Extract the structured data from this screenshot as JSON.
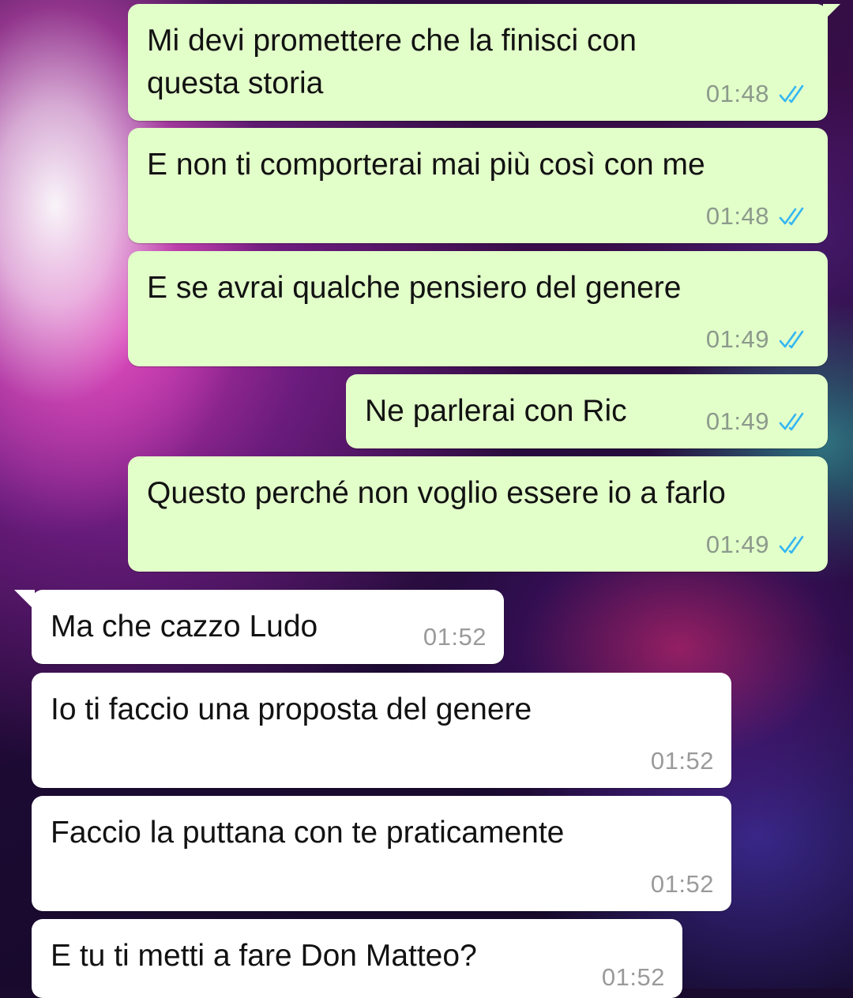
{
  "chat": {
    "messages": [
      {
        "direction": "out",
        "text": "Mi devi promettere che la finisci con\nquesta storia",
        "time": "01:48",
        "status_icon": "double-check-read-icon"
      },
      {
        "direction": "out",
        "text": "E non ti comporterai mai più così con me",
        "time": "01:48",
        "status_icon": "double-check-read-icon"
      },
      {
        "direction": "out",
        "text": "E se avrai qualche pensiero del genere",
        "time": "01:49",
        "status_icon": "double-check-read-icon"
      },
      {
        "direction": "out",
        "text": "Ne parlerai con Ric",
        "time": "01:49",
        "status_icon": "double-check-read-icon"
      },
      {
        "direction": "out",
        "text": "Questo perché non voglio essere io a farlo",
        "time": "01:49",
        "status_icon": "double-check-read-icon"
      },
      {
        "direction": "in",
        "text": "Ma che cazzo Ludo",
        "time": "01:52"
      },
      {
        "direction": "in",
        "text": "Io ti faccio una proposta del genere",
        "time": "01:52"
      },
      {
        "direction": "in",
        "text": "Faccio la puttana con te praticamente",
        "time": "01:52"
      },
      {
        "direction": "in",
        "text": "E tu ti metti a fare Don Matteo?",
        "time": "01:52"
      }
    ]
  },
  "colors": {
    "outgoing_bubble": "#e2fec9",
    "incoming_bubble": "#ffffff",
    "read_check": "#34b7f1"
  }
}
